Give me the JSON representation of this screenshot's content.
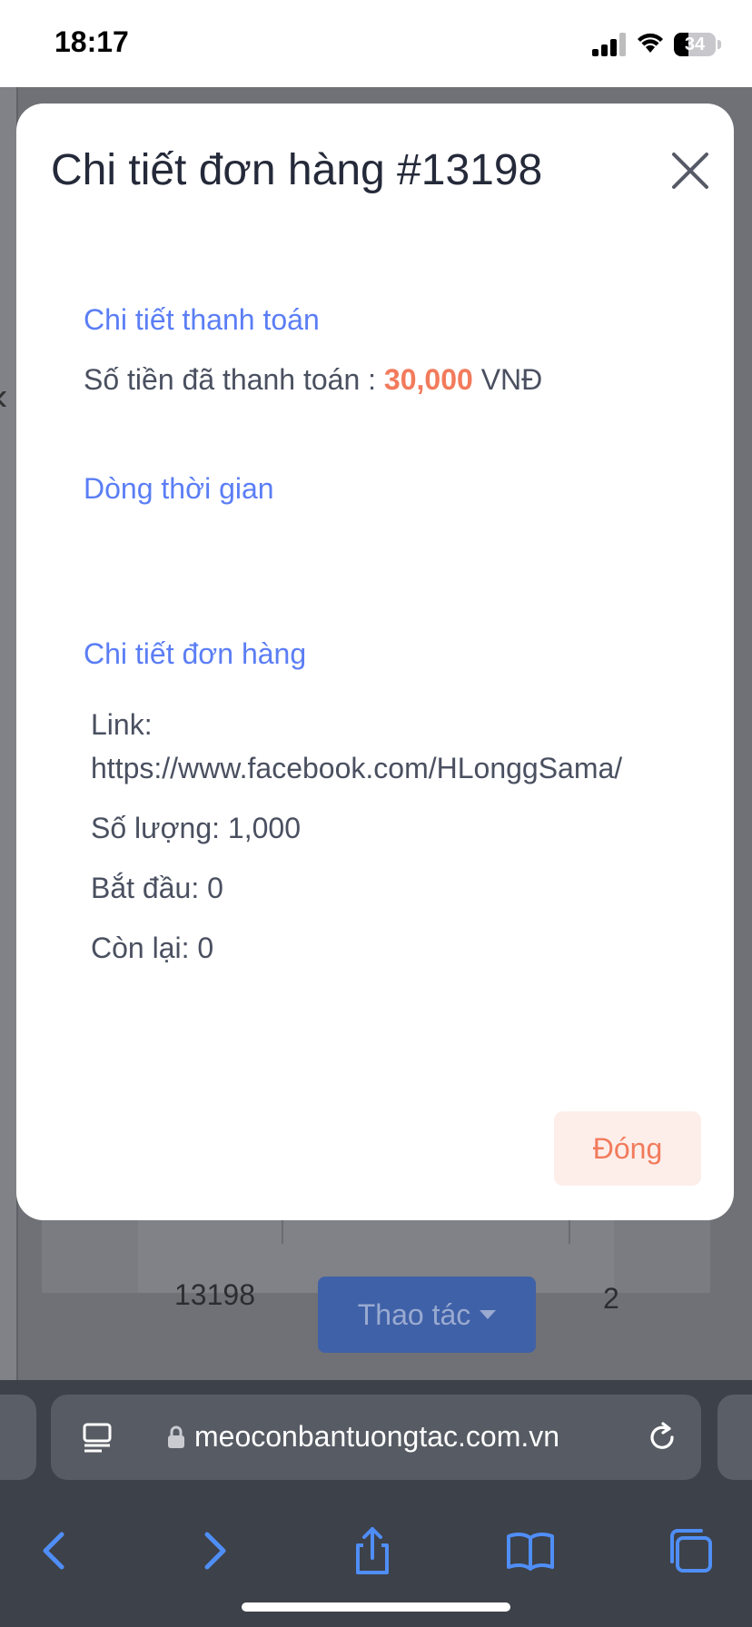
{
  "status_bar": {
    "time": "18:17",
    "battery": "34"
  },
  "modal": {
    "title": "Chi tiết đơn hàng #13198",
    "payment": {
      "heading": "Chi tiết thanh toán",
      "paid_label": "Số tiền đã thanh toán : ",
      "paid_amount": "30,000",
      "currency": " VNĐ"
    },
    "timeline": {
      "heading": "Dòng thời gian"
    },
    "order": {
      "heading": "Chi tiết đơn hàng",
      "link_label": "Link:",
      "link_value": "https://www.facebook.com/HLonggSama/",
      "quantity": "Số lượng: 1,000",
      "start": "Bắt đầu: 0",
      "remaining": "Còn lại: 0"
    },
    "close_button": "Đóng"
  },
  "background": {
    "row_id": "13198",
    "action_button": "Thao tác",
    "clipped_cell": "2"
  },
  "browser": {
    "url": "meoconbantuongtac.com.vn"
  },
  "colors": {
    "accent_blue": "#5b7ef5",
    "amount_orange": "#f27b5c",
    "close_btn_bg": "#fdeeea",
    "ios_blue": "#4f8ef7"
  }
}
